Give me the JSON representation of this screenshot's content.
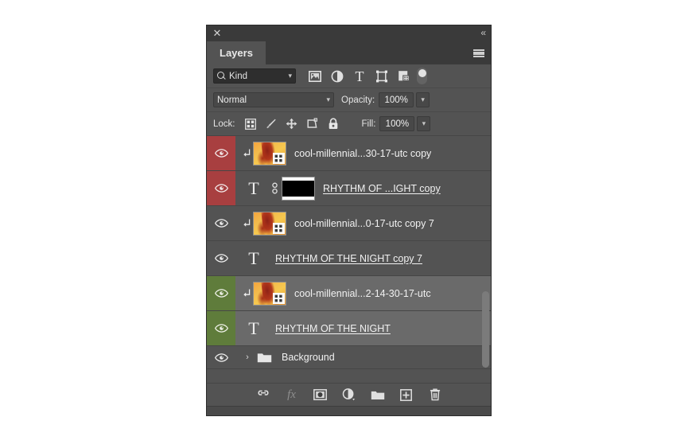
{
  "window": {
    "close_icon": "close-icon",
    "collapse_icon": "double-chevron-left-icon",
    "menu_icon": "panel-menu-icon"
  },
  "tabs": [
    {
      "label": "Layers",
      "active": true
    }
  ],
  "filter": {
    "kind_label": "Kind",
    "search_icon": "search-icon",
    "caret": "⌄",
    "icons": [
      {
        "name": "filter-pixel-layers-icon"
      },
      {
        "name": "filter-adjustment-layers-icon"
      },
      {
        "name": "filter-type-layers-icon"
      },
      {
        "name": "filter-shape-layers-icon"
      },
      {
        "name": "filter-smart-object-layers-icon"
      }
    ],
    "toggle_name": "filter-enable-toggle"
  },
  "blend": {
    "mode": "Normal",
    "opacity_label": "Opacity:",
    "opacity_value": "100%",
    "caret": "⌄"
  },
  "lock": {
    "label": "Lock:",
    "icons": [
      {
        "name": "lock-transparent-pixels-icon"
      },
      {
        "name": "lock-image-pixels-icon"
      },
      {
        "name": "lock-position-icon"
      },
      {
        "name": "lock-artboard-nesting-icon"
      },
      {
        "name": "lock-all-icon"
      }
    ],
    "fill_label": "Fill:",
    "fill_value": "100%"
  },
  "layers": [
    {
      "name": "cool-millennial...30-17-utc copy",
      "type": "smart-object",
      "visible": true,
      "selected": false,
      "eye_color": "#a83f40",
      "eye_state": "red",
      "clipped": true,
      "underline": false
    },
    {
      "name": "RHYTHM OF ...IGHT copy",
      "type": "type-with-mask",
      "visible": true,
      "selected": false,
      "eye_color": "#a83f40",
      "eye_state": "red",
      "clipped": false,
      "underline": true,
      "linked": true
    },
    {
      "name": "cool-millennial...0-17-utc copy 7",
      "type": "smart-object",
      "visible": true,
      "selected": false,
      "eye_color": "none",
      "eye_state": "plain",
      "clipped": true,
      "underline": false
    },
    {
      "name": "RHYTHM OF THE NIGHT copy 7",
      "type": "type",
      "visible": true,
      "selected": false,
      "eye_color": "none",
      "eye_state": "plain",
      "clipped": false,
      "underline": true
    },
    {
      "name": "cool-millennial...2-14-30-17-utc",
      "type": "smart-object",
      "visible": true,
      "selected": true,
      "eye_color": "#5f7c3b",
      "eye_state": "green",
      "clipped": true,
      "underline": false
    },
    {
      "name": "RHYTHM OF THE NIGHT",
      "type": "type",
      "visible": true,
      "selected": true,
      "eye_color": "#5f7c3b",
      "eye_state": "green",
      "clipped": false,
      "underline": true
    }
  ],
  "background_row": {
    "name": "Background",
    "visible": true,
    "disclosure": "›",
    "icon": "folder-icon"
  },
  "scrollbar": {
    "thumb_top_pct": 63,
    "thumb_height_pct": 31
  },
  "bottom_toolbar": [
    {
      "name": "link-layers-button",
      "glyph": "link-icon",
      "dim": false
    },
    {
      "name": "layer-style-button",
      "glyph": "fx",
      "dim": true
    },
    {
      "name": "add-layer-mask-button",
      "glyph": "mask-icon",
      "dim": false
    },
    {
      "name": "new-adjustment-layer-button",
      "glyph": "adjustment-icon",
      "dim": false
    },
    {
      "name": "new-group-button",
      "glyph": "folder-icon",
      "dim": false
    },
    {
      "name": "new-layer-button",
      "glyph": "plus-square-icon",
      "dim": false
    },
    {
      "name": "delete-layer-button",
      "glyph": "trash-icon",
      "dim": false
    }
  ],
  "colors": {
    "panel_bg": "#535353",
    "chrome": "#3a3a3a",
    "row_selected": "#6a6a6a",
    "label_red": "#a83f40",
    "label_green": "#5f7c3b",
    "text": "#f1f1f1"
  }
}
